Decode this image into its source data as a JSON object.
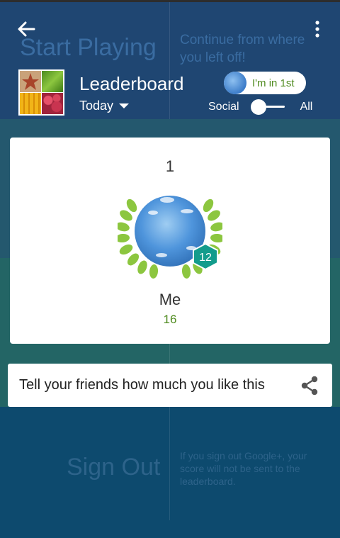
{
  "background": {
    "start_playing": "Start Playing",
    "continue_text": "Continue from where you left off!",
    "sign_out": "Sign Out",
    "sign_out_note": "If you sign out Google+, your score will not be sent to the leaderboard."
  },
  "header": {
    "back_icon": "arrow-left-icon",
    "menu_icon": "more-vert-icon",
    "title": "Leaderboard",
    "time_filter": "Today",
    "im_in_first": "I'm in 1st",
    "social_label": "Social",
    "all_label": "All"
  },
  "rank_card": {
    "rank": "1",
    "level": "12",
    "player_name": "Me",
    "score": "16"
  },
  "share": {
    "text": "Tell your friends how much you like this",
    "icon": "share-icon"
  },
  "colors": {
    "accent_green": "#4f8b1f",
    "laurel_green": "#8cc63f",
    "badge_teal": "#139c8c",
    "header_bg": "#1f4672"
  }
}
